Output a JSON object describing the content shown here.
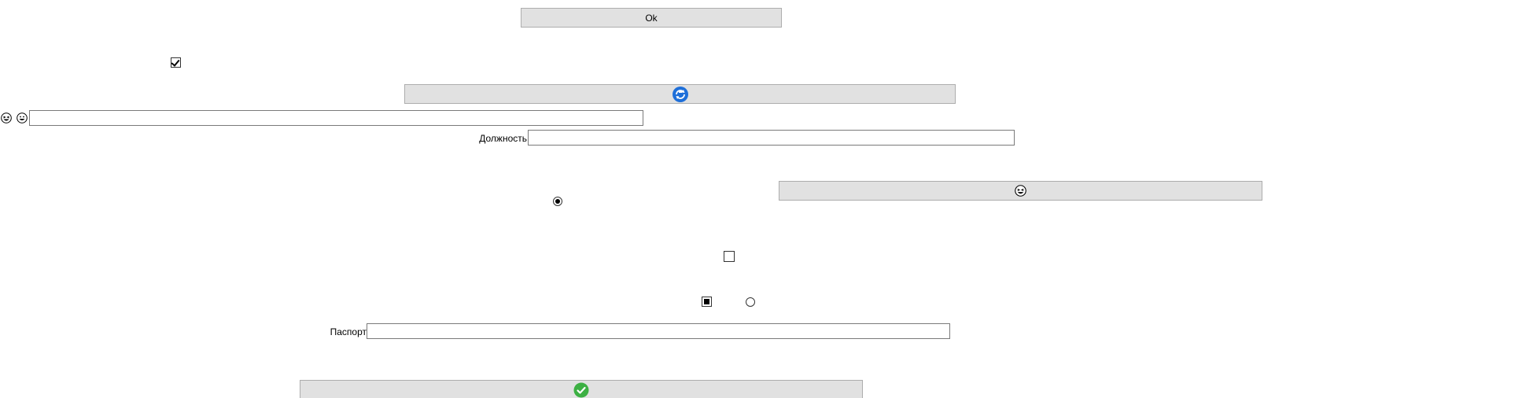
{
  "buttons": {
    "ok_label": "Ok"
  },
  "fields": {
    "position_label": "Должность",
    "position_value": "",
    "passport_label": "Паспорт",
    "passport_value": "",
    "emoji_field_value": ""
  },
  "checkboxes": {
    "top_checkbox_checked": true,
    "middle_checkbox_checked": false,
    "lower_checkbox_state": "indeterminate"
  },
  "radios": {
    "middle_radio_selected": true,
    "lower_radio_selected": false
  },
  "icons": {
    "refresh_button_icon": "refresh-circle-icon",
    "laugh_button_icon": "grinning-squint-face-icon",
    "confirm_button_icon": "check-circle-icon",
    "left_icon_1": "grinning-squint-face-icon",
    "left_icon_2": "grinning-face-icon"
  },
  "colors": {
    "button_bg": "#e1e1e1",
    "button_border": "#adadad",
    "input_border": "#7a7a7a",
    "refresh_blue": "#1e6fd9",
    "check_green": "#3cb043"
  }
}
